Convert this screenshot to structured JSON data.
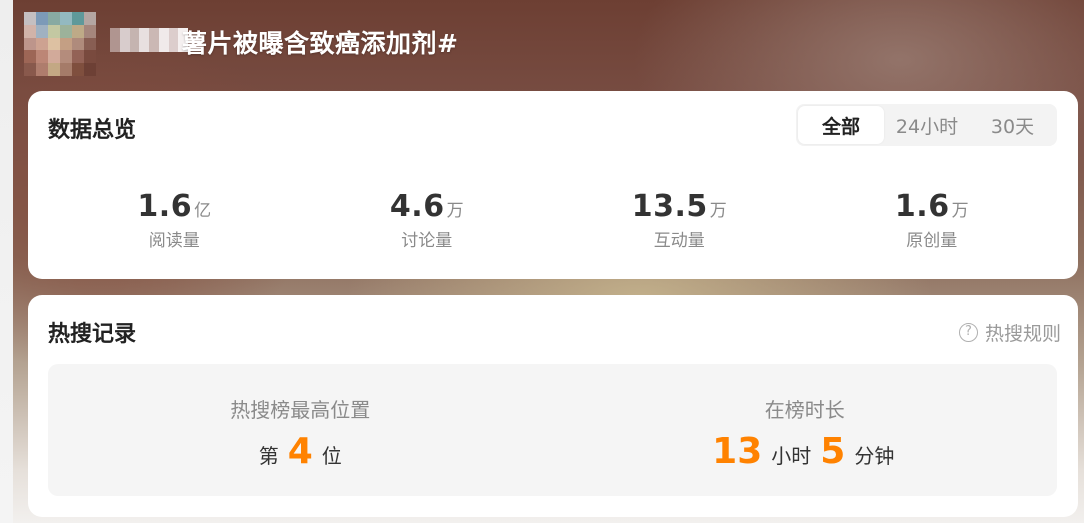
{
  "header": {
    "topic_title": "薯片被曝含致癌添加剂#"
  },
  "overview": {
    "title": "数据总览",
    "tabs": [
      {
        "label": "全部",
        "active": true
      },
      {
        "label": "24小时",
        "active": false
      },
      {
        "label": "30天",
        "active": false
      }
    ],
    "stats": [
      {
        "value": "1.6",
        "unit": "亿",
        "label": "阅读量"
      },
      {
        "value": "4.6",
        "unit": "万",
        "label": "讨论量"
      },
      {
        "value": "13.5",
        "unit": "万",
        "label": "互动量"
      },
      {
        "value": "1.6",
        "unit": "万",
        "label": "原创量"
      }
    ]
  },
  "hot_search": {
    "title": "热搜记录",
    "rules_icon": "question-circle-icon",
    "rules_label": "热搜规则",
    "highest_position": {
      "label": "热搜榜最高位置",
      "prefix": "第",
      "value": "4",
      "suffix": "位"
    },
    "duration": {
      "label": "在榜时长",
      "hours": "13",
      "hours_unit": "小时",
      "minutes": "5",
      "minutes_unit": "分钟"
    }
  },
  "colors": {
    "accent_orange": "#ff8200",
    "text_dark": "#333333",
    "text_muted": "#8a8a8a",
    "card_bg": "#ffffff",
    "panel_bg": "#f5f5f5"
  }
}
